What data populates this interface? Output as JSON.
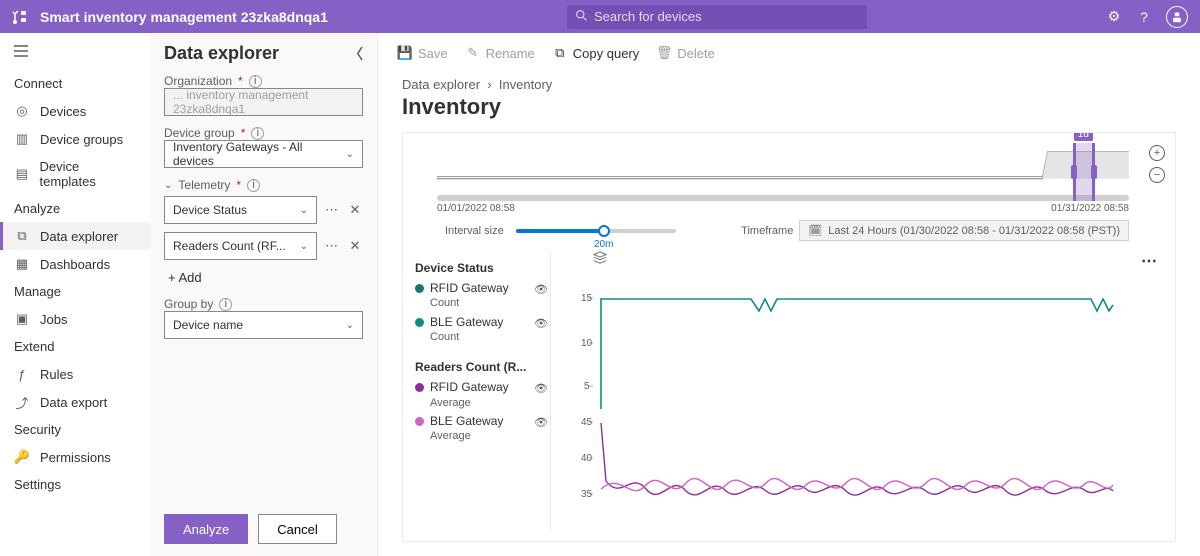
{
  "topbar": {
    "app_title": "Smart inventory management 23zka8dnqa1",
    "search_placeholder": "Search for devices"
  },
  "nav": {
    "sections": {
      "connect": "Connect",
      "analyze": "Analyze",
      "manage": "Manage",
      "extend": "Extend",
      "security": "Security",
      "settings": "Settings"
    },
    "items": {
      "devices": "Devices",
      "device_groups": "Device groups",
      "device_templates": "Device templates",
      "data_explorer": "Data explorer",
      "dashboards": "Dashboards",
      "jobs": "Jobs",
      "rules": "Rules",
      "data_export": "Data export",
      "permissions": "Permissions"
    }
  },
  "panel": {
    "title": "Data explorer",
    "org_label": "Organization",
    "org_value": "... inventory management 23zka8dnqa1",
    "devgroup_label": "Device group",
    "devgroup_value": "Inventory Gateways - All devices",
    "telemetry_label": "Telemetry",
    "telemetry1": "Device Status",
    "telemetry2": "Readers Count (RF...",
    "add": "+ Add",
    "groupby_label": "Group by",
    "groupby_value": "Device name",
    "analyze": "Analyze",
    "cancel": "Cancel"
  },
  "cmd": {
    "save": "Save",
    "rename": "Rename",
    "copy": "Copy query",
    "delete": "Delete"
  },
  "main": {
    "crumb_root": "Data explorer",
    "crumb_leaf": "Inventory",
    "title": "Inventory"
  },
  "timeline": {
    "start": "01/01/2022 08:58",
    "end": "01/31/2022 08:58",
    "badge": "1d",
    "interval_label": "Interval size",
    "interval_value": "20m",
    "timeframe_label": "Timeframe",
    "timeframe_value": "Last 24 Hours (01/30/2022 08:58 - 01/31/2022 08:58 (PST))"
  },
  "legend": {
    "g1": "Device Status",
    "g1e1": "RFID Gateway",
    "g1e1s": "Count",
    "g1c1": "#107c6f",
    "g1e2": "BLE Gateway",
    "g1e2s": "Count",
    "g1c2": "#0b8f7e",
    "g2": "Readers Count (R...",
    "g2e1": "RFID Gateway",
    "g2e1s": "Average",
    "g2c1": "#8a2da5",
    "g2e2": "BLE Gateway",
    "g2e2s": "Average",
    "g2c2": "#d160c9"
  },
  "chart_data": [
    {
      "type": "line",
      "title": "Device Status",
      "ylabel": "Count",
      "ylim": [
        0,
        16
      ],
      "yticks": [
        5,
        10,
        15
      ],
      "series": [
        {
          "name": "RFID Gateway",
          "color": "#107c6f",
          "values_desc": "Step from 0 to ~15 at start, flat around 15, brief dip to ~13 mid, recovers, dips to ~13 at end"
        },
        {
          "name": "BLE Gateway",
          "color": "#0b8f7e",
          "values_desc": "Overlapping similar step/flat near 15"
        }
      ]
    },
    {
      "type": "line",
      "title": "Readers Count (R...)",
      "ylabel": "Average",
      "ylim": [
        30,
        48
      ],
      "yticks": [
        35,
        40,
        45
      ],
      "series": [
        {
          "name": "RFID Gateway",
          "color": "#8a2da5",
          "values_desc": "Starts ~45, drops and oscillates between ~33 and ~40"
        },
        {
          "name": "BLE Gateway",
          "color": "#d160c9",
          "values_desc": "Oscillates between ~34 and ~39 across range"
        }
      ]
    }
  ]
}
